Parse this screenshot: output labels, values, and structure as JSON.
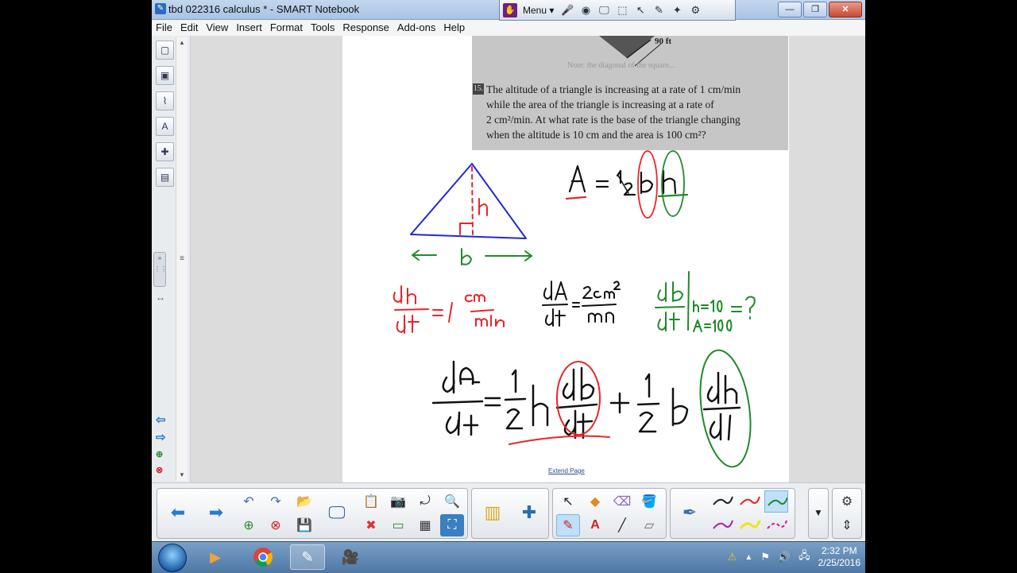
{
  "window": {
    "title": "tbd 022316  calculus * - SMART Notebook",
    "minimize": "—",
    "maximize": "❐",
    "close": "✕"
  },
  "floating_toolbar": {
    "menu_label": "Menu ▾"
  },
  "menu": [
    "File",
    "Edit",
    "View",
    "Insert",
    "Format",
    "Tools",
    "Response",
    "Add-ons",
    "Help"
  ],
  "scan": {
    "measure": "90 ft",
    "problem_number": "15.",
    "problem_lines": [
      "The altitude of a triangle is increasing at a rate of 1 cm/min",
      "while the area of the triangle is increasing at a rate of",
      "2 cm²/min. At what rate is the base of the triangle changing",
      "when the altitude is 10 cm and the area is 100 cm²?"
    ]
  },
  "extend_page": "Extend Page",
  "colors": {
    "ink_red": "#e8262a",
    "ink_green": "#1f8a2a",
    "ink_blue": "#2626d4",
    "ink_black": "#111111",
    "accent": "#2a7ac8"
  },
  "taskbar": {
    "time": "2:32 PM",
    "date": "2/25/2016"
  }
}
